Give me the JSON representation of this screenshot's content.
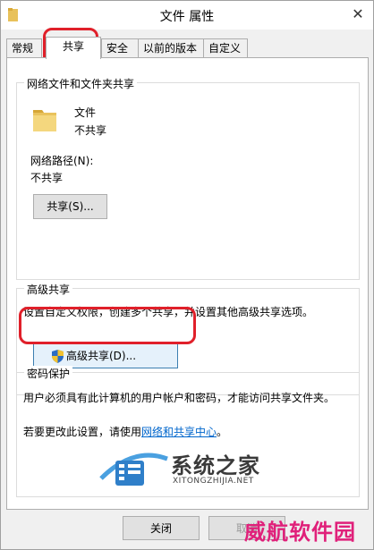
{
  "window": {
    "title": "文件 属性",
    "close_glyph": "✕"
  },
  "tabs": [
    {
      "label": "常规"
    },
    {
      "label": "共享"
    },
    {
      "label": "安全"
    },
    {
      "label": "以前的版本"
    },
    {
      "label": "自定义"
    }
  ],
  "network_sharing": {
    "title": "网络文件和文件夹共享",
    "item_name": "文件",
    "item_status": "不共享",
    "network_path_label": "网络路径(N):",
    "network_path_value": "不共享",
    "share_button": "共享(S)..."
  },
  "advanced_sharing": {
    "title": "高级共享",
    "description": "设置自定义权限，创建多个共享，并设置其他高级共享选项。",
    "button": "高级共享(D)..."
  },
  "password_protection": {
    "title": "密码保护",
    "description": "用户必须具有此计算机的用户帐户和密码，才能访问共享文件夹。",
    "change_prefix": "若要更改此设置，请使用",
    "link": "网络和共享中心",
    "change_suffix": "。"
  },
  "footer": {
    "close_button": "关闭",
    "cancel_button": "取消"
  },
  "watermark": {
    "brand": "系统之家",
    "brand_url": "XITONGZHIJIA.NET",
    "corner": "威航软件园"
  },
  "colors": {
    "highlight_ring": "#e0202a",
    "link": "#0066cc",
    "watermark_corner": "#e0207a"
  }
}
